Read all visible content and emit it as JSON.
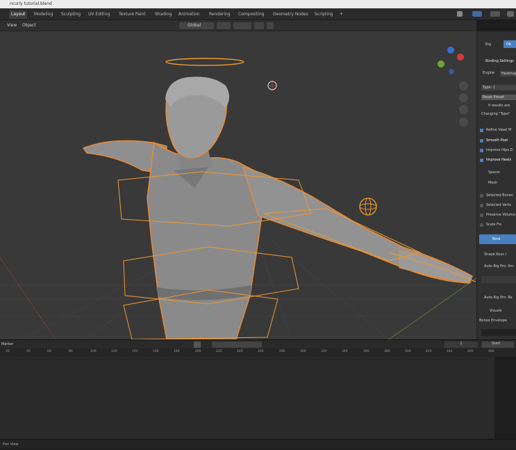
{
  "window_title": "ncurly tutorial.blend",
  "workspace_tabs": [
    "Layout",
    "Modeling",
    "Sculpting",
    "UV Editing",
    "Texture Paint",
    "Shading",
    "Animation",
    "Rendering",
    "Compositing",
    "Geometry Nodes",
    "Scripting",
    "+"
  ],
  "header": {
    "view": "View",
    "object": "Object",
    "orientation": "Global"
  },
  "sidebar": {
    "tabs": [
      "Rig",
      "Ob"
    ],
    "section_title": "Binding Settings",
    "engine_label": "Engine",
    "engine_value": "Heatmap",
    "type_value": "Type: 1",
    "preset_label": "Reset Preset",
    "info": "If results are",
    "changing": "Changing \"Type\"",
    "checks": [
      {
        "label": "Refine Voxel M",
        "on": true
      },
      {
        "label": "Smooth Post",
        "on": true
      },
      {
        "label": "Improve Hips D",
        "on": true
      },
      {
        "label": "Improve Heels",
        "on": true
      }
    ],
    "spacer": "Spacer",
    "mesh": "Mesh",
    "options": [
      {
        "label": "Selected Bones",
        "on": false
      },
      {
        "label": "Selected Verts",
        "on": false
      },
      {
        "label": "Preserve Volume",
        "on": false
      },
      {
        "label": "Scale Fix",
        "on": false
      }
    ],
    "bind_label": "Bind",
    "shape_keys": "Shape Keys (",
    "pro_label1": "Auto-Rig Pro: Sm",
    "pro_label2": "Auto-Rig Pro: Re",
    "visuals": "Visuals",
    "bones": "Bones Envelope"
  },
  "timeline": {
    "label": "Marker",
    "current_frame": "1",
    "start_label": "Start",
    "ticks": [
      "20",
      "40",
      "60",
      "80",
      "100",
      "120",
      "140",
      "160",
      "180",
      "200",
      "220",
      "240",
      "260",
      "280",
      "300",
      "320",
      "340",
      "360",
      "380",
      "400",
      "420",
      "440",
      "460",
      "480"
    ]
  },
  "statusbar": {
    "text": "Pan View"
  }
}
